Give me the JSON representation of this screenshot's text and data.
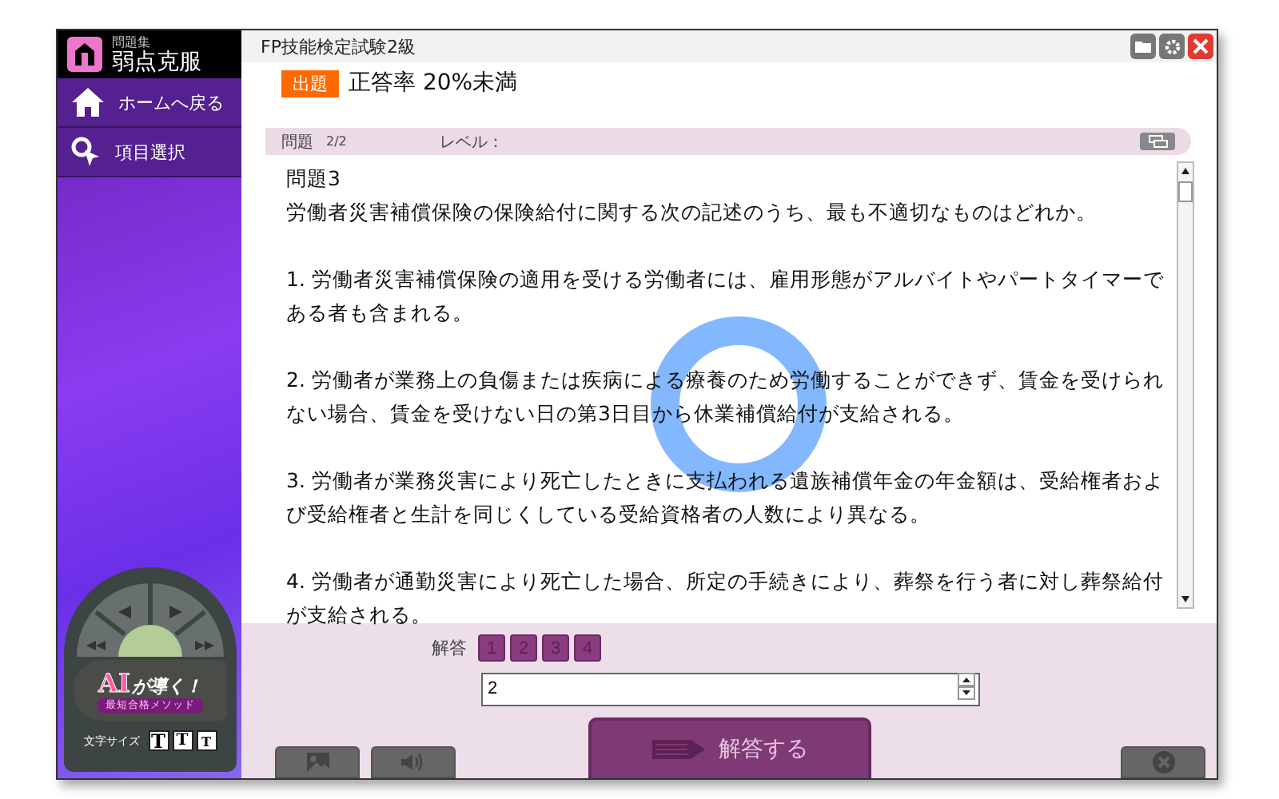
{
  "sidebar": {
    "logo": {
      "caption": "問題集",
      "title": "弱点克服"
    },
    "menu": [
      {
        "label": "ホームへ戻る",
        "kind": "home"
      },
      {
        "label": "項目選択",
        "kind": "search"
      }
    ],
    "controller": {
      "badge_main": "AI",
      "badge_sub": "が導く！",
      "tagline": "最短合格メソッド",
      "font_size_label": "文字サイズ",
      "font_size_buttons": [
        "T",
        "T",
        "T"
      ]
    }
  },
  "window": {
    "title": "FP技能検定試験2級"
  },
  "filter": {
    "tag": "出題",
    "label": "正答率 20%未満"
  },
  "question_bar": {
    "label": "問題",
    "count": "2/2",
    "level_label": "レベル："
  },
  "question": {
    "title": "問題3",
    "stem": "労働者災害補償保険の保険給付に関する次の記述のうち、最も不適切なものはどれか。",
    "options": [
      "1.  労働者災害補償保険の適用を受ける労働者には、雇用形態がアルバイトやパートタイマーである者も含まれる。",
      "2.  労働者が業務上の負傷または疾病による療養のため労働することができず、賃金を受けられない場合、賃金を受けない日の第3日目から休業補償給付が支給される。",
      "3.  労働者が業務災害により死亡したときに支払われる遺族補償年金の年金額は、受給権者および受給権者と生計を同じくしている受給資格者の人数により異なる。",
      "4.  労働者が通勤災害により死亡した場合、所定の手続きにより、葬祭を行う者に対し葬祭給付が支給される。"
    ]
  },
  "answer": {
    "label": "解答",
    "choices": [
      "1",
      "2",
      "3",
      "4"
    ],
    "value": "2",
    "submit": "解答する"
  }
}
